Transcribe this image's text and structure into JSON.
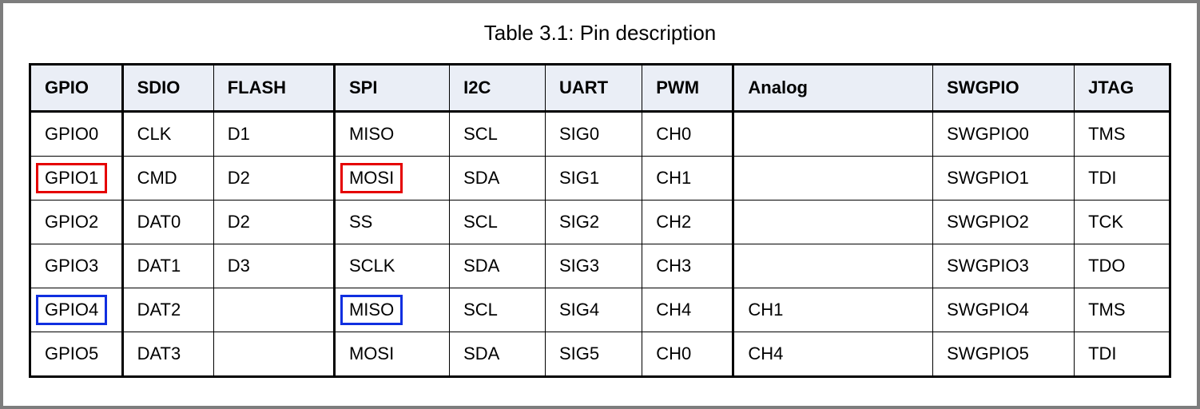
{
  "caption": "Table 3.1: Pin description",
  "headers": [
    "GPIO",
    "SDIO",
    "FLASH",
    "SPI",
    "I2C",
    "UART",
    "PWM",
    "Analog",
    "SWGPIO",
    "JTAG"
  ],
  "rows": [
    [
      "GPIO0",
      "CLK",
      "D1",
      "MISO",
      "SCL",
      "SIG0",
      "CH0",
      "",
      "SWGPIO0",
      "TMS"
    ],
    [
      "GPIO1",
      "CMD",
      "D2",
      "MOSI",
      "SDA",
      "SIG1",
      "CH1",
      "",
      "SWGPIO1",
      "TDI"
    ],
    [
      "GPIO2",
      "DAT0",
      "D2",
      "SS",
      "SCL",
      "SIG2",
      "CH2",
      "",
      "SWGPIO2",
      "TCK"
    ],
    [
      "GPIO3",
      "DAT1",
      "D3",
      "SCLK",
      "SDA",
      "SIG3",
      "CH3",
      "",
      "SWGPIO3",
      "TDO"
    ],
    [
      "GPIO4",
      "DAT2",
      "",
      "MISO",
      "SCL",
      "SIG4",
      "CH4",
      "CH1",
      "SWGPIO4",
      "TMS"
    ],
    [
      "GPIO5",
      "DAT3",
      "",
      "MOSI",
      "SDA",
      "SIG5",
      "CH0",
      "CH4",
      "SWGPIO5",
      "TDI"
    ]
  ],
  "highlight_red": [
    [
      1,
      0
    ],
    [
      1,
      3
    ]
  ],
  "highlight_blue": [
    [
      4,
      0
    ],
    [
      4,
      3
    ]
  ]
}
